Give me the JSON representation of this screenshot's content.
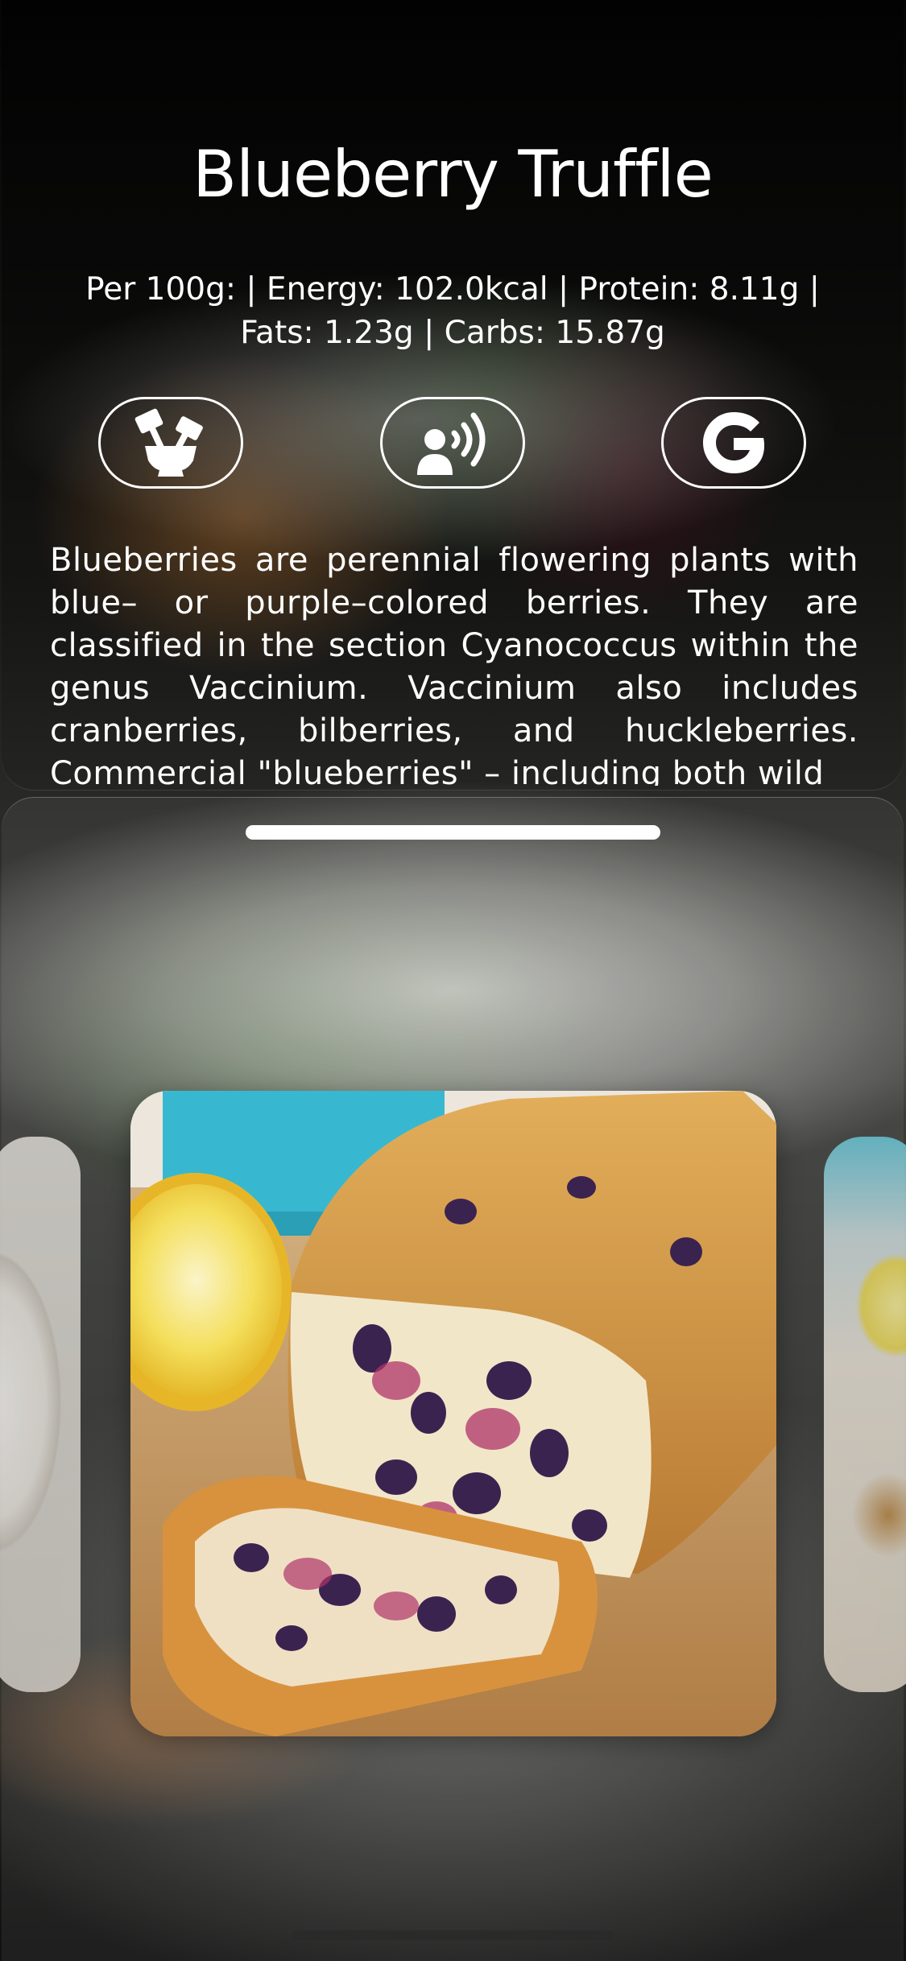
{
  "dish": {
    "title": "Blueberry Truffle",
    "nutrition": "Per 100g: | Energy: 102.0kcal | Protein: 8.11g | Fats: 1.23g | Carbs: 15.87g",
    "description": "Blueberries are perennial flowering plants with blue– or purple–colored berries. They are classified in the section Cyanococcus within the genus Vaccinium. Vaccinium also includes cranberries, bilberries, and huckleberries. Commercial \"blueberries\" – including both wild"
  },
  "actions": [
    {
      "icon": "cooking-tools-icon"
    },
    {
      "icon": "speaker-voice-icon"
    },
    {
      "icon": "google-icon"
    }
  ],
  "carousel": {
    "items": [
      {
        "image": "previous-dish-photo"
      },
      {
        "image": "blueberry-loaf-photo"
      },
      {
        "image": "next-dish-photo"
      }
    ]
  },
  "colors": {
    "text": "#ffffff",
    "button_border": "#ffffff",
    "grabber": "#ffffff"
  }
}
